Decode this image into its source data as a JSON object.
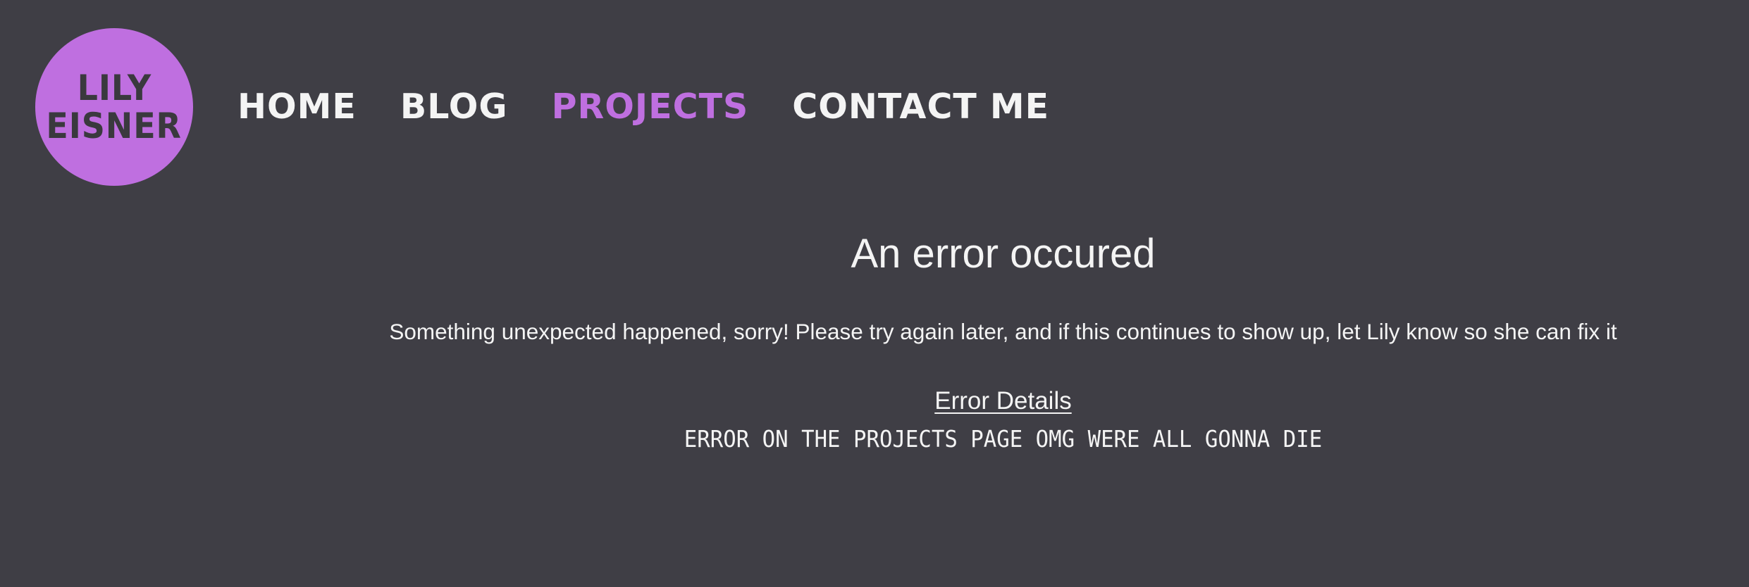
{
  "logo": {
    "line1": "LILY",
    "line2": "EISNER"
  },
  "nav": {
    "items": [
      {
        "label": "HOME",
        "active": false
      },
      {
        "label": "BLOG",
        "active": false
      },
      {
        "label": "PROJECTS",
        "active": true
      },
      {
        "label": "CONTACT ME",
        "active": false
      }
    ]
  },
  "error": {
    "title": "An error occured",
    "message": "Something unexpected happened, sorry! Please try again later, and if this continues to show up, let Lily know so she can fix it",
    "details_label": "Error Details",
    "details_text": "ERROR ON THE PROJECTS PAGE OMG WERE ALL GONNA DIE"
  },
  "colors": {
    "background": "#3f3e45",
    "accent": "#bf6fe0",
    "text": "#f4f4f4",
    "logo_text": "#3a393e"
  }
}
